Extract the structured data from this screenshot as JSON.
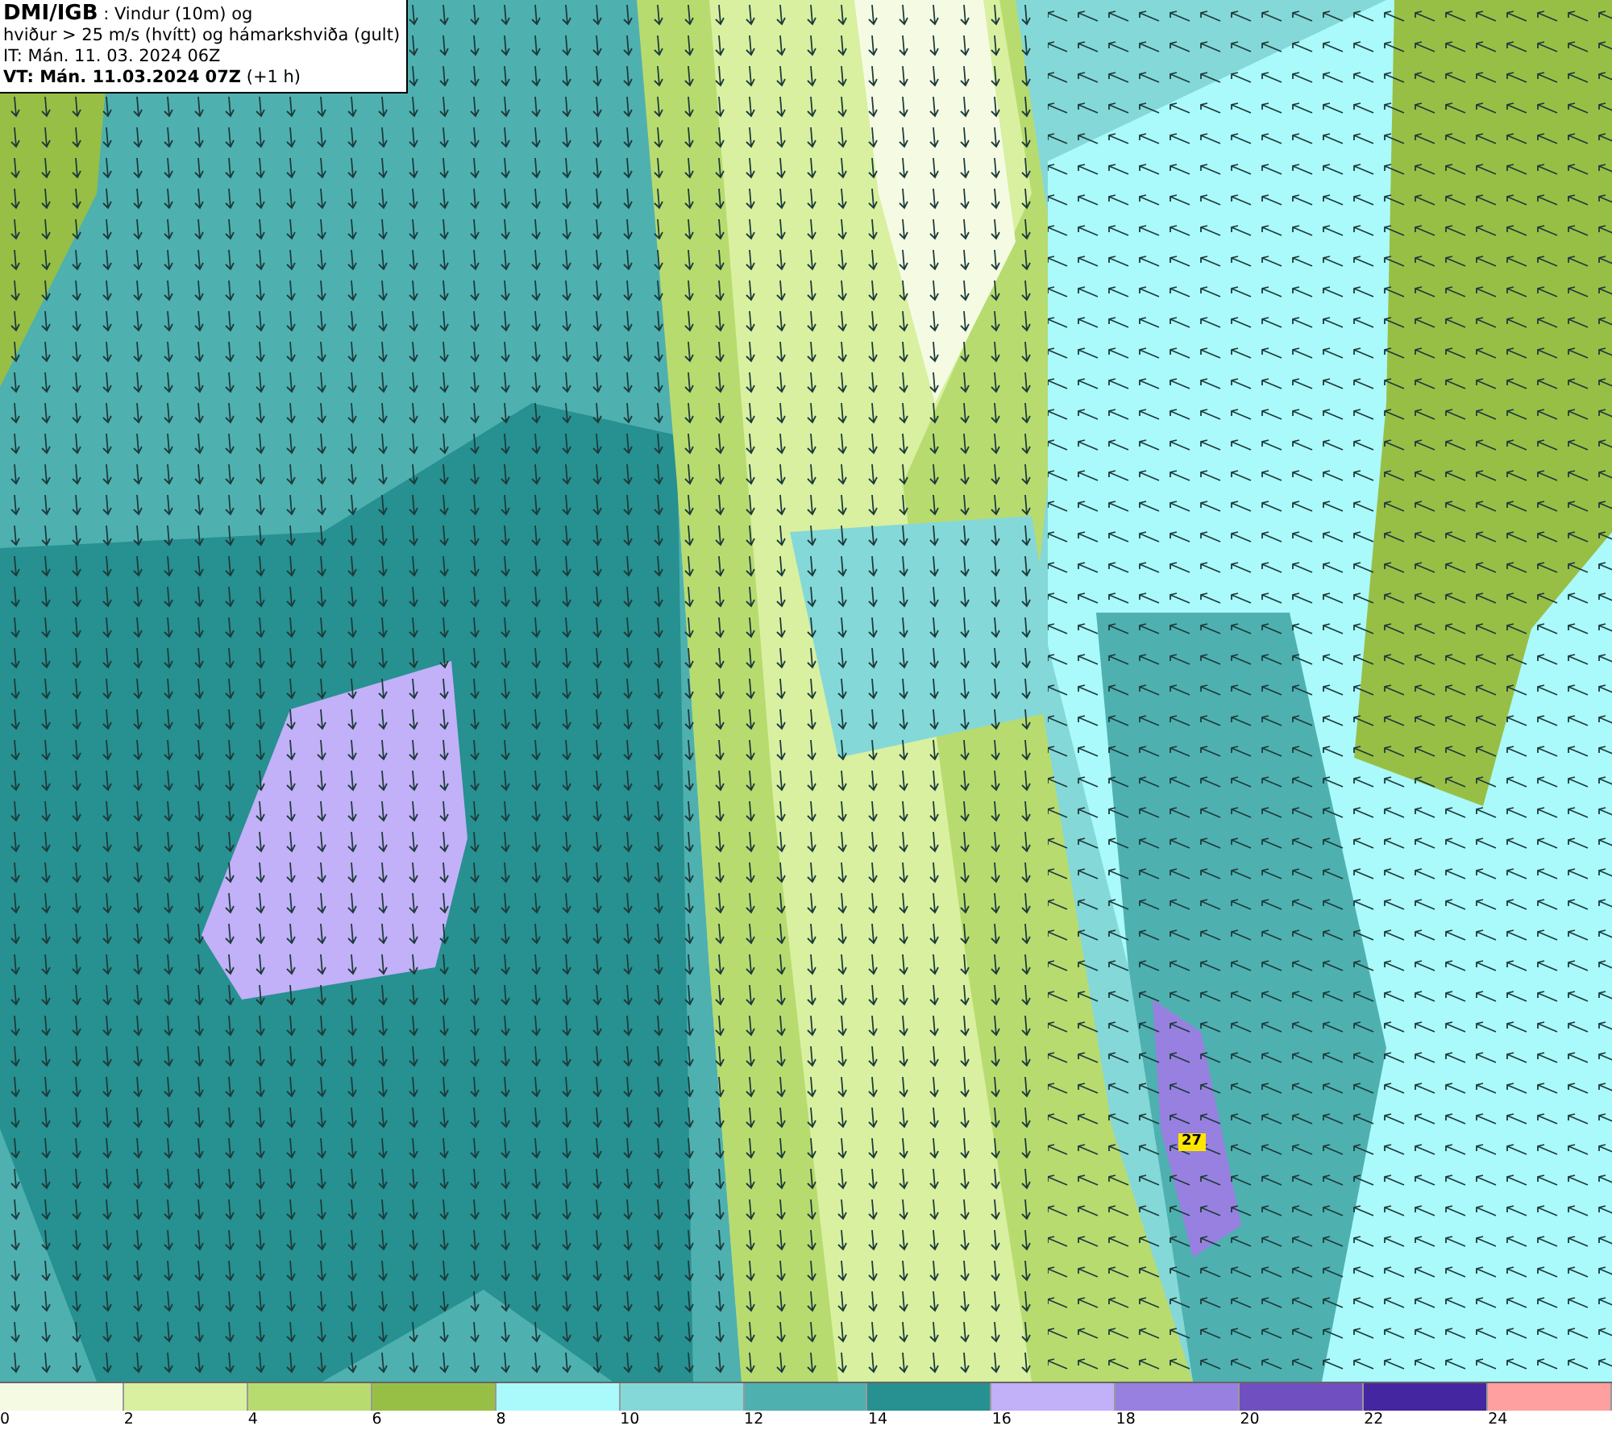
{
  "title_box": {
    "lines": [
      "**DMI/IGB** : Vindur (10m) og",
      "hviður > 25 m/s (hvítt) og hámarkshviða (gult)",
      "IT: Mán. 11. 03. 2024 06Z",
      "**VT: Mán. 11.03.2024 07Z** (+1 h)"
    ]
  },
  "map": {
    "max_gust_label": "27"
  },
  "legend": {
    "swatches": [
      {
        "color": "#f5fbe3"
      },
      {
        "color": "#d8f0a0"
      },
      {
        "color": "#b8db70"
      },
      {
        "color": "#98bf45"
      },
      {
        "color": "#aaf9fb"
      },
      {
        "color": "#84d8d8"
      },
      {
        "color": "#4fb0b0"
      },
      {
        "color": "#279090"
      },
      {
        "color": "#c2b0f8"
      },
      {
        "color": "#9880e0"
      },
      {
        "color": "#7050c0"
      },
      {
        "color": "#4426a0"
      },
      {
        "color": "#ffa0a0"
      }
    ],
    "ticks": [
      "0",
      "2",
      "4",
      "6",
      "8",
      "10",
      "12",
      "14",
      "16",
      "18",
      "20",
      "22",
      "24"
    ]
  }
}
